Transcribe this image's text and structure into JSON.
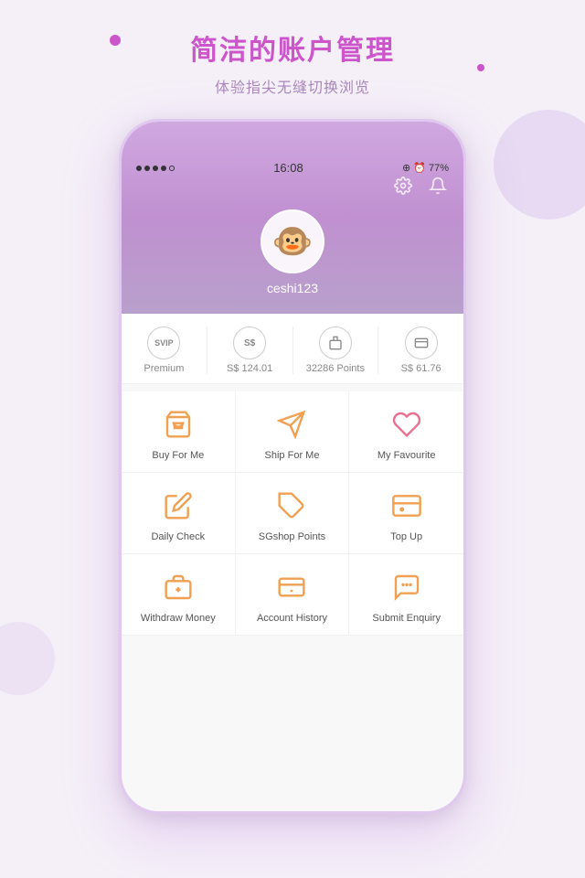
{
  "page": {
    "title": "简洁的账户管理",
    "subtitle": "体验指尖无缝切换浏览"
  },
  "status_bar": {
    "dots": [
      "filled",
      "filled",
      "filled",
      "filled",
      "empty"
    ],
    "time": "16:08",
    "right_text": "⊕ ⏰ 77%"
  },
  "profile": {
    "username": "ceshi123",
    "avatar_emoji": "🐵"
  },
  "stats": [
    {
      "icon": "SVIP",
      "label": "Premium"
    },
    {
      "icon": "S$",
      "label": "S$ 124.01"
    },
    {
      "icon": "🎁",
      "label": "32286 Points"
    },
    {
      "icon": "🎫",
      "label": "S$ 61.76"
    }
  ],
  "menu_items": [
    {
      "id": "buy-for-me",
      "label": "Buy For Me",
      "icon_type": "bag"
    },
    {
      "id": "ship-for-me",
      "label": "Ship For Me",
      "icon_type": "plane"
    },
    {
      "id": "my-favourite",
      "label": "My Favourite",
      "icon_type": "heart"
    },
    {
      "id": "daily-check",
      "label": "Daily Check",
      "icon_type": "pencil"
    },
    {
      "id": "sgshop-points",
      "label": "SGshop Points",
      "icon_type": "tag"
    },
    {
      "id": "top-up",
      "label": "Top Up",
      "icon_type": "card"
    },
    {
      "id": "withdraw-money",
      "label": "Withdraw Money",
      "icon_type": "wallet"
    },
    {
      "id": "account-history",
      "label": "Account History",
      "icon_type": "history"
    },
    {
      "id": "submit-enquiry",
      "label": "Submit Enquiry",
      "icon_type": "chat"
    }
  ]
}
